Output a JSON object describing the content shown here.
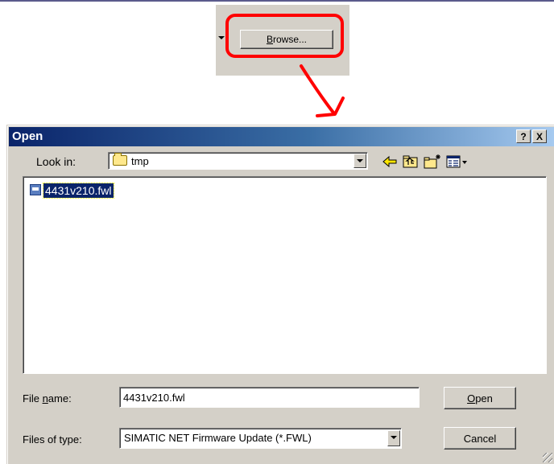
{
  "browse_snippet": {
    "button_label": "Browse..."
  },
  "dialog": {
    "title": "Open",
    "help_label": "?",
    "close_label": "X",
    "look_in": {
      "label": "Look in:",
      "value": "tmp"
    },
    "toolbar": {
      "icons": [
        "back-arrow-icon",
        "up-folder-icon",
        "new-folder-icon",
        "view-menu-icon"
      ]
    },
    "files": [
      {
        "name": "4431v210.fwl",
        "selected": true
      }
    ],
    "file_name": {
      "label": "File name:",
      "value": "4431v210.fwl"
    },
    "file_type": {
      "label": "Files of type:",
      "value": "SIMATIC NET Firmware Update (*.FWL)"
    },
    "open_label": "Open",
    "cancel_label": "Cancel"
  },
  "colors": {
    "annotation_red": "#ff0000",
    "title_bar_start": "#0a246a",
    "title_bar_end": "#a6caf0",
    "dialog_face": "#d4d0c8",
    "selection": "#0a246a"
  }
}
